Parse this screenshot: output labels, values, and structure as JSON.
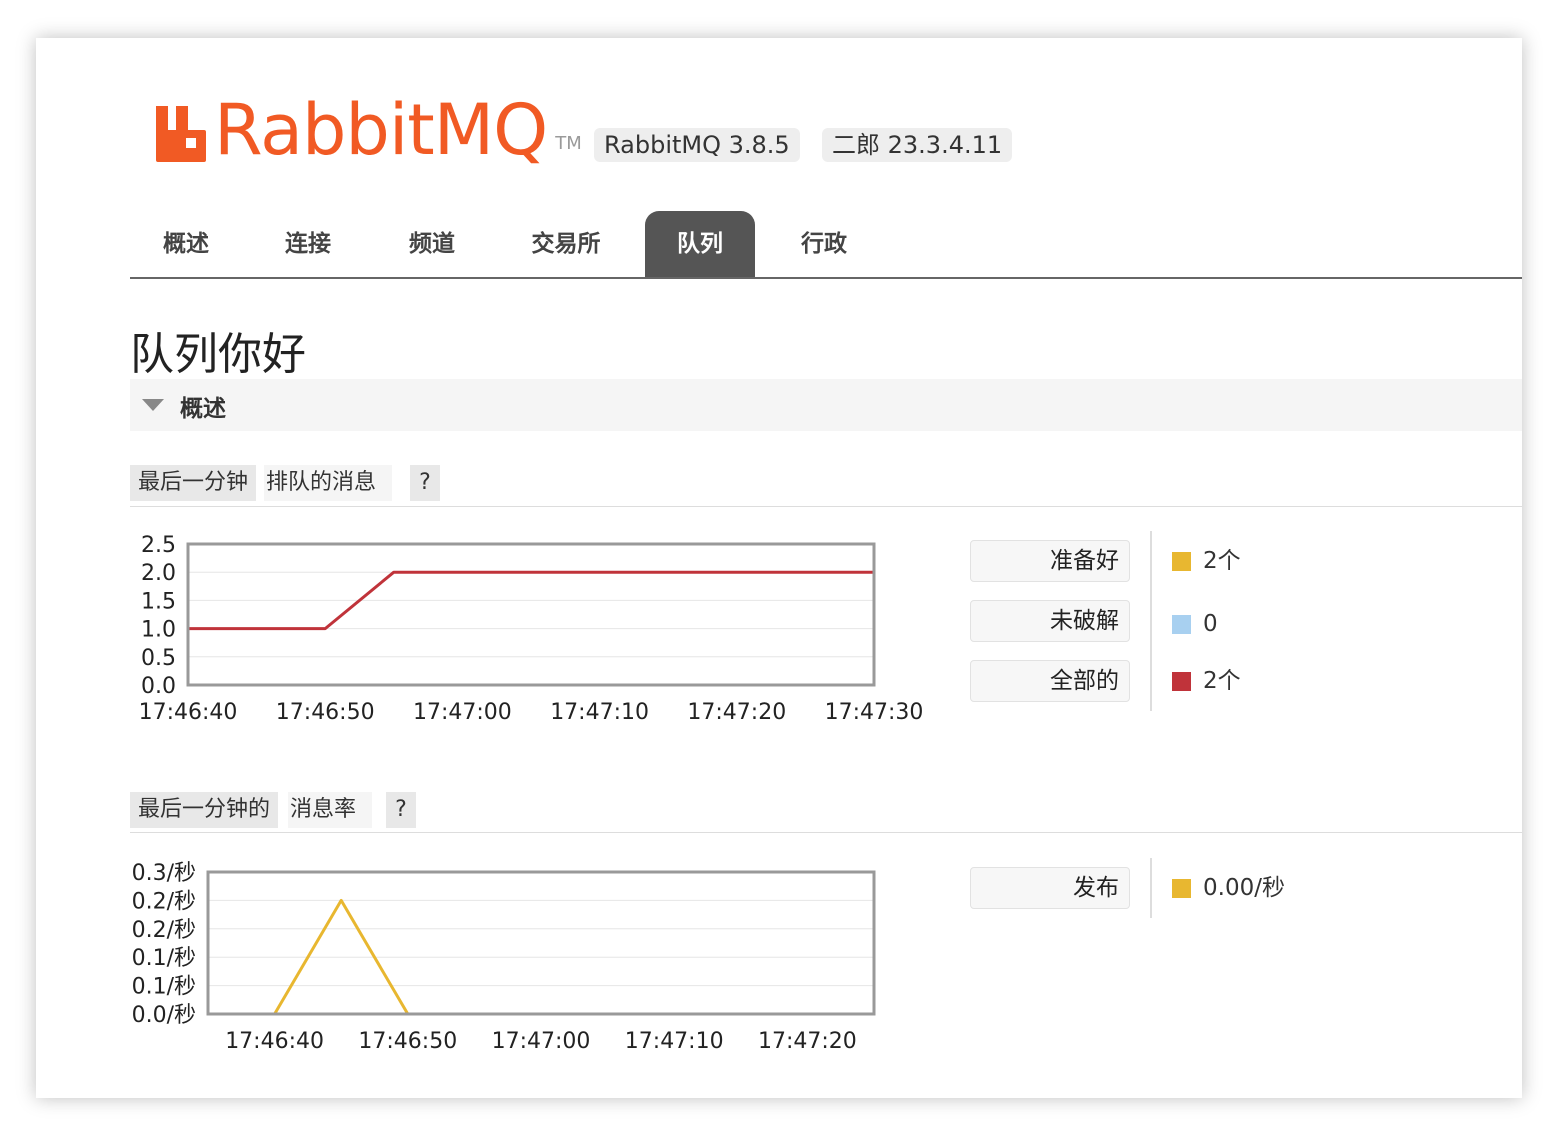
{
  "header": {
    "logo_rabbit": "RabbitMQ",
    "logo_brand_color": "#f15a24",
    "logo_tm": "TM",
    "version_badge": "RabbitMQ 3.8.5",
    "erlang_badge": "二郎 23.3.4.11"
  },
  "nav": {
    "tabs": [
      {
        "label": "概述",
        "active": false
      },
      {
        "label": "连接",
        "active": false
      },
      {
        "label": "频道",
        "active": false
      },
      {
        "label": "交易所",
        "active": false
      },
      {
        "label": "队列",
        "active": true
      },
      {
        "label": "行政",
        "active": false
      }
    ]
  },
  "page": {
    "title": "队列你好",
    "section_label": "概述"
  },
  "queued_chart": {
    "heading_chip": "最后一分钟",
    "heading_text": "排队的消息",
    "help": "?",
    "legend": [
      {
        "label": "准备好",
        "value": "2个",
        "color": "#e8b730"
      },
      {
        "label": "未破解",
        "value": "0",
        "color": "#a8d0f0"
      },
      {
        "label": "全部的",
        "value": "2个",
        "color": "#c0333a"
      }
    ]
  },
  "rates_chart": {
    "heading_chip": "最后一分钟的",
    "heading_text": "消息率",
    "help": "?",
    "legend": [
      {
        "label": "发布",
        "value": "0.00/秒",
        "color": "#e8b730"
      }
    ]
  },
  "chart_data": [
    {
      "type": "line",
      "x_ticks": [
        "17:46:40",
        "17:46:50",
        "17:47:00",
        "17:47:10",
        "17:47:20",
        "17:47:30"
      ],
      "y_ticks": [
        "0.0",
        "0.5",
        "1.0",
        "1.5",
        "2.0",
        "2.5"
      ],
      "ylim": [
        0,
        2.5
      ],
      "xlim": [
        "17:46:40",
        "17:47:30"
      ],
      "grid": true,
      "series": [
        {
          "name": "全部的",
          "color": "#c0333a",
          "x": [
            "17:46:40",
            "17:46:50",
            "17:46:55",
            "17:47:30"
          ],
          "y": [
            1,
            1,
            2,
            2
          ]
        },
        {
          "name": "准备好",
          "color": "#e8b730",
          "x": [
            "17:46:40",
            "17:47:30"
          ],
          "y": [
            0,
            0
          ]
        },
        {
          "name": "未破解",
          "color": "#a8d0f0",
          "x": [
            "17:46:40",
            "17:47:30"
          ],
          "y": [
            0,
            0
          ]
        }
      ]
    },
    {
      "type": "line",
      "x_ticks": [
        "17:46:40",
        "17:46:50",
        "17:47:00",
        "17:47:10",
        "17:47:20"
      ],
      "y_ticks": [
        "0.0/秒",
        "0.1/秒",
        "0.1/秒",
        "0.2/秒",
        "0.2/秒",
        "0.3/秒"
      ],
      "ylim": [
        0,
        0.25
      ],
      "xlim": [
        "17:46:35",
        "17:47:25"
      ],
      "grid": true,
      "series": [
        {
          "name": "发布",
          "color": "#e8b730",
          "x": [
            "17:46:35",
            "17:46:40",
            "17:46:45",
            "17:46:50",
            "17:47:25"
          ],
          "y": [
            0,
            0,
            0.2,
            0,
            0
          ]
        }
      ]
    }
  ]
}
